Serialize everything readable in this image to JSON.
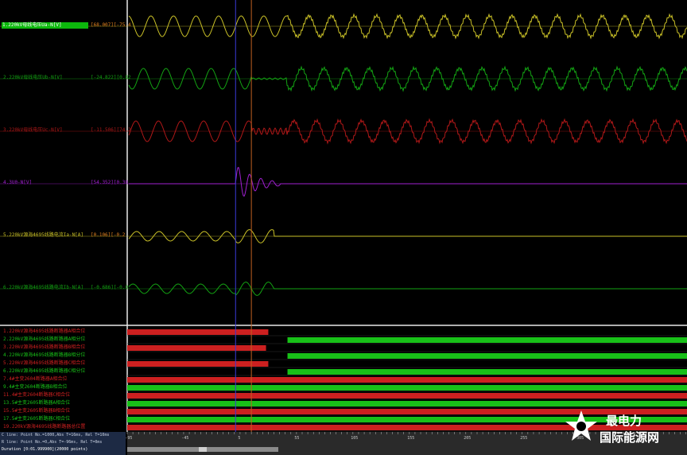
{
  "channels": [
    {
      "label": "1.220kV母线电压Ua-N[V]",
      "value": "[68.007]",
      "extra": "[-75.4",
      "color": "#c9c027",
      "label_color": "#ffffff"
    },
    {
      "label": "2.220kV母线电压Ub-N[V]",
      "value": "[-24.822]",
      "extra": "[0.82",
      "color": "#13a313",
      "label_color": "#13a313"
    },
    {
      "label": "3.220kV母线电压Uc-N[V]",
      "value": "[-11.506]",
      "extra": "[74.2",
      "color": "#b01818",
      "label_color": "#b01818"
    },
    {
      "label": "4.3U0-N[V]",
      "value": "[54.352]",
      "extra": "[0.38",
      "color": "#a020d0",
      "label_color": "#a020d0"
    },
    {
      "label": "5.220kV源海4695线路电流Ia-N[A]",
      "value": "[0.106]",
      "extra": "[-0.2",
      "color": "#c9c027",
      "label_color": "#c9c027"
    },
    {
      "label": "6.220kV源海4695线路电流Ib-N[A]",
      "value": "[-0.686]",
      "extra": "[-0.0",
      "color": "#13a313",
      "label_color": "#13a313"
    }
  ],
  "digital": [
    {
      "label": "1.220kV源海4695线路断路器A相合位",
      "color": "#cc2020"
    },
    {
      "label": "2.220kV源海4695线路断路器A相分位",
      "color": "#18c018"
    },
    {
      "label": "3.220kV源海4695线路断路器B相合位",
      "color": "#cc2020"
    },
    {
      "label": "4.220kV源海4695线路断路器B相分位",
      "color": "#18c018"
    },
    {
      "label": "5.220kV源海4695线路断路器C相合位",
      "color": "#cc2020"
    },
    {
      "label": "6.220kV源海4695线路断路器C相分位",
      "color": "#18c018"
    },
    {
      "label": "7.4#主变2604断路器A相合位",
      "color": "#cc2020"
    },
    {
      "label": "9.4#主变2604断路器B相合位",
      "color": "#18c018"
    },
    {
      "label": "11.4#主变2604断路器C相合位",
      "color": "#cc2020"
    },
    {
      "label": "13.5#主变2605断路器A相合位",
      "color": "#18c018"
    },
    {
      "label": "15.5#主变2605断路器B相合位",
      "color": "#cc2020"
    },
    {
      "label": "17.5#主变2605断路器C相合位",
      "color": "#18c018"
    },
    {
      "label": "19.220kV源海4695线路断路器总位置",
      "color": "#cc2020"
    }
  ],
  "digital_bars": [
    {
      "color": "#cc2020",
      "segments": [
        [
          -96,
          29
        ]
      ]
    },
    {
      "color": "#18c018",
      "segments": [
        [
          46,
          400
        ]
      ]
    },
    {
      "color": "#cc2020",
      "segments": [
        [
          -96,
          27
        ]
      ]
    },
    {
      "color": "#18c018",
      "segments": [
        [
          46,
          400
        ]
      ]
    },
    {
      "color": "#cc2020",
      "segments": [
        [
          -96,
          29
        ]
      ]
    },
    {
      "color": "#18c018",
      "segments": [
        [
          46,
          400
        ]
      ]
    },
    {
      "color": "#cc2020",
      "segments": [
        [
          -96,
          400
        ]
      ]
    },
    {
      "color": "#18c018",
      "segments": [
        [
          -96,
          400
        ]
      ]
    },
    {
      "color": "#cc2020",
      "segments": [
        [
          -96,
          400
        ]
      ]
    },
    {
      "color": "#18c018",
      "segments": [
        [
          -96,
          400
        ]
      ]
    },
    {
      "color": "#cc2020",
      "segments": [
        [
          -96,
          400
        ]
      ]
    },
    {
      "color": "#18c018",
      "segments": [
        [
          -96,
          400
        ]
      ]
    },
    {
      "color": "#cc2020",
      "segments": [
        [
          -96,
          400
        ]
      ]
    }
  ],
  "cursors": {
    "C": {
      "t_ms": 0,
      "color": "#3a3ad8"
    },
    "R": {
      "t_ms": 14,
      "color": "#c06020"
    }
  },
  "axis": {
    "min": -96,
    "max": 400,
    "ticks": [
      "-95",
      "-45",
      "5",
      "55",
      "105",
      "155",
      "205",
      "255",
      "305"
    ]
  },
  "status": {
    "c_line": "C line: Point No.=1000,Abs T=16ms, Rel T=10ms",
    "r_line": "R line: Point No.=0,Abs T=-96ms, Rel T=0ms",
    "duration": "Duration [0:01.999900](20000 points)"
  },
  "logo": {
    "line1": "北极星电力",
    "line2": "国际能源网",
    "visible_line1": "最电力"
  }
}
